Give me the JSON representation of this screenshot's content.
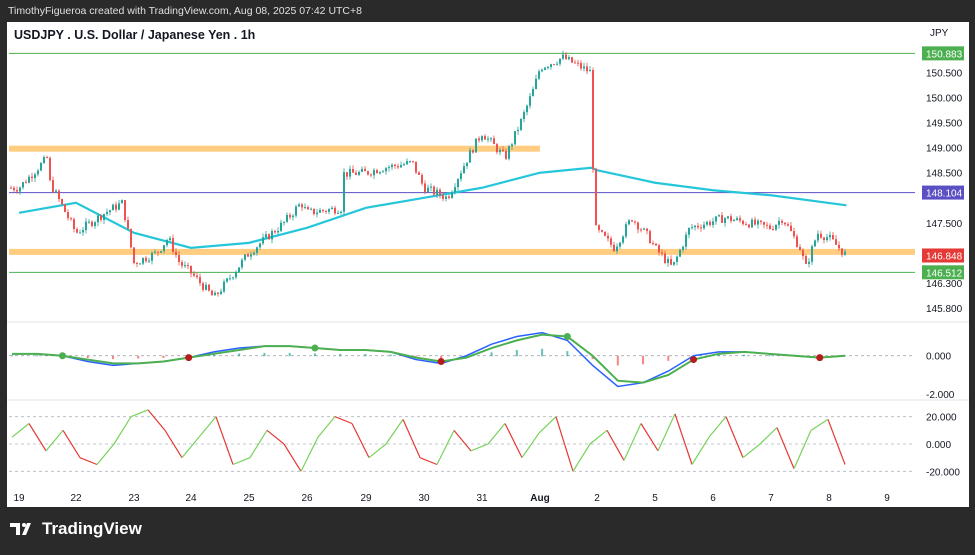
{
  "header": {
    "created_by": "TimothyFigueroa created with TradingView.com, Aug 08, 2025 07:42 UTC+8"
  },
  "brand": {
    "name": "TradingView",
    "logo_icon": "tradingview-logo-icon"
  },
  "chart_data": [
    {
      "type": "candlestick",
      "title": "USDJPY . U.S. Dollar / Japanese Yen . 1h",
      "currency": "JPY",
      "ylim": [
        145.6,
        151.05
      ],
      "y_ticks": [
        "150.500",
        "150.000",
        "149.500",
        "149.000",
        "148.500",
        "147.500",
        "146.300",
        "145.800"
      ],
      "x_ticks": [
        "19",
        "22",
        "23",
        "24",
        "25",
        "26",
        "29",
        "30",
        "31",
        "Aug",
        "2",
        "5",
        "6",
        "7",
        "8",
        "9"
      ],
      "price_labels": [
        {
          "value": "150.883",
          "color": "#4caf50"
        },
        {
          "value": "148.104",
          "color": "#5b4fc4"
        },
        {
          "value": "146.848",
          "color": "#e53935"
        },
        {
          "value": "146.512",
          "color": "#4caf50"
        }
      ],
      "horizontal_lines": [
        {
          "y": 150.883,
          "color": "#4caf50",
          "kind": "line"
        },
        {
          "y": 148.104,
          "color": "#5b4fc4",
          "kind": "line"
        },
        {
          "y": 146.512,
          "color": "#4caf50",
          "kind": "line"
        },
        {
          "y": 148.98,
          "color": "#ffcc80",
          "kind": "zone",
          "x_end": "Aug"
        },
        {
          "y": 146.92,
          "color": "#ffcc80",
          "kind": "zone"
        }
      ],
      "close_path": [
        [
          "19",
          148.2
        ],
        [
          "19.5",
          148.8
        ],
        [
          "21.5",
          148.4
        ],
        [
          "22",
          147.3
        ],
        [
          "22.5",
          147.7
        ],
        [
          "22.8",
          147.9
        ],
        [
          "23",
          146.7
        ],
        [
          "23.4",
          146.9
        ],
        [
          "23.6",
          147.2
        ],
        [
          "23.8",
          146.7
        ],
        [
          "24",
          146.5
        ],
        [
          "24.4",
          146.0
        ],
        [
          "24.8",
          146.6
        ],
        [
          "25",
          146.9
        ],
        [
          "25.3",
          147.2
        ],
        [
          "25.6",
          147.5
        ],
        [
          "25.9",
          147.9
        ],
        [
          "26",
          147.7
        ],
        [
          "26.6",
          147.8
        ],
        [
          "27",
          148.2
        ],
        [
          "29",
          148.5
        ],
        [
          "29.3",
          148.6
        ],
        [
          "29.8",
          148.7
        ],
        [
          "30",
          148.2
        ],
        [
          "30.4",
          148.0
        ],
        [
          "30.8",
          148.9
        ],
        [
          "31",
          149.3
        ],
        [
          "31.4",
          148.8
        ],
        [
          "31.7",
          149.6
        ],
        [
          "31.9",
          150.2
        ],
        [
          "Aug",
          150.6
        ],
        [
          "1.4",
          150.8
        ],
        [
          "1.9",
          150.5
        ],
        [
          "1.95",
          147.4
        ],
        [
          "2.3",
          147.0
        ],
        [
          "2.6",
          147.6
        ],
        [
          "2.9",
          147.2
        ],
        [
          "5",
          147.0
        ],
        [
          "5.3",
          146.6
        ],
        [
          "5.6",
          147.4
        ],
        [
          "5.9",
          147.5
        ],
        [
          "6.2",
          147.6
        ],
        [
          "6.6",
          147.5
        ],
        [
          "7",
          147.4
        ],
        [
          "7.2",
          147.6
        ],
        [
          "7.5",
          147.0
        ],
        [
          "7.6",
          146.6
        ],
        [
          "7.8",
          147.3
        ],
        [
          "8",
          147.2
        ],
        [
          "8.3",
          146.848
        ]
      ],
      "moving_average": [
        [
          "19",
          147.7
        ],
        [
          "22",
          147.9
        ],
        [
          "23",
          147.3
        ],
        [
          "24",
          147.0
        ],
        [
          "25",
          147.1
        ],
        [
          "26",
          147.4
        ],
        [
          "29",
          147.8
        ],
        [
          "30",
          148.0
        ],
        [
          "31",
          148.2
        ],
        [
          "Aug",
          148.5
        ],
        [
          "1.9",
          148.6
        ],
        [
          "2",
          148.55
        ],
        [
          "5",
          148.3
        ],
        [
          "6",
          148.15
        ],
        [
          "7",
          148.05
        ],
        [
          "8.3",
          147.85
        ]
      ]
    },
    {
      "type": "line",
      "name": "oscillator-1",
      "y_ticks": [
        "0.000",
        "-2.000"
      ],
      "series_1": [
        0.1,
        0.1,
        0.0,
        -0.3,
        -0.5,
        -0.4,
        -0.3,
        -0.1,
        0.2,
        0.4,
        0.5,
        0.5,
        0.4,
        0.3,
        0.3,
        0.2,
        -0.2,
        -0.4,
        0.0,
        0.6,
        1.0,
        1.2,
        0.8,
        -0.5,
        -1.6,
        -1.4,
        -0.8,
        0.0,
        0.2,
        0.2,
        0.1,
        0.0,
        -0.1,
        0.0
      ],
      "series_2": [
        0.1,
        0.1,
        0.0,
        -0.2,
        -0.4,
        -0.4,
        -0.3,
        -0.1,
        0.1,
        0.3,
        0.5,
        0.5,
        0.4,
        0.3,
        0.3,
        0.2,
        -0.1,
        -0.3,
        -0.1,
        0.4,
        0.8,
        1.1,
        1.0,
        0.0,
        -1.3,
        -1.4,
        -1.0,
        -0.2,
        0.1,
        0.2,
        0.1,
        0.0,
        -0.1,
        0.0
      ],
      "ylim": [
        -2.2,
        1.6
      ]
    },
    {
      "type": "line",
      "name": "oscillator-2",
      "y_ticks": [
        "20.000",
        "0.000",
        "-20.000"
      ],
      "values": [
        5,
        15,
        -5,
        10,
        -10,
        -15,
        0,
        20,
        25,
        10,
        -10,
        5,
        20,
        -15,
        -10,
        10,
        0,
        -20,
        5,
        20,
        15,
        -10,
        0,
        18,
        -10,
        -15,
        10,
        -5,
        0,
        15,
        -10,
        8,
        20,
        -20,
        0,
        10,
        -12,
        15,
        -5,
        22,
        -15,
        5,
        20,
        -10,
        0,
        12,
        -18,
        10,
        18,
        -15
      ],
      "ylim": [
        -30,
        30
      ]
    }
  ]
}
